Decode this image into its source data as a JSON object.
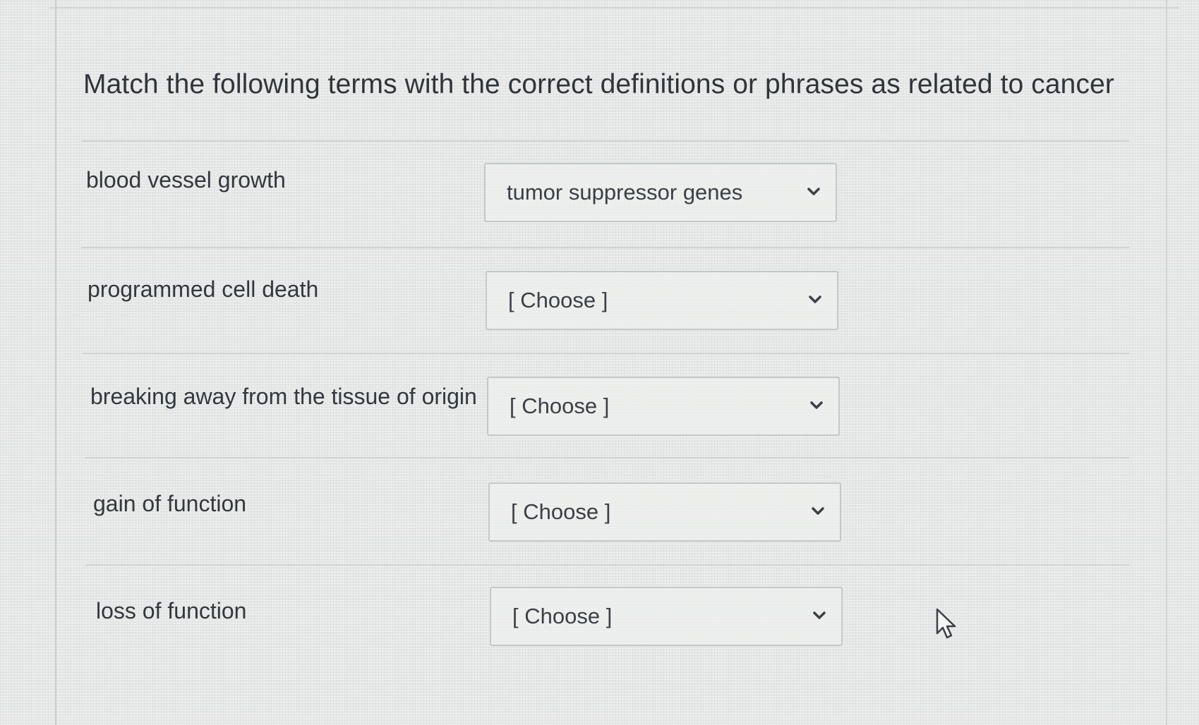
{
  "question": {
    "text": "Match the following terms with the correct definitions or phrases as related to cancer"
  },
  "rows": [
    {
      "term": "blood vessel growth",
      "selected": "tumor suppressor genes"
    },
    {
      "term": "programmed cell death",
      "selected": "[ Choose ]"
    },
    {
      "term": "breaking away from the tissue of origin",
      "selected": "[ Choose ]"
    },
    {
      "term": "gain of function",
      "selected": "[ Choose ]"
    },
    {
      "term": "loss of function",
      "selected": "[ Choose ]"
    }
  ],
  "icons": {
    "dropdown": "chevron-down-icon",
    "cursor": "mouse-pointer-icon"
  },
  "colors": {
    "text": "#32383d",
    "border": "#c4c8c7",
    "background": "#e6e8e7"
  }
}
